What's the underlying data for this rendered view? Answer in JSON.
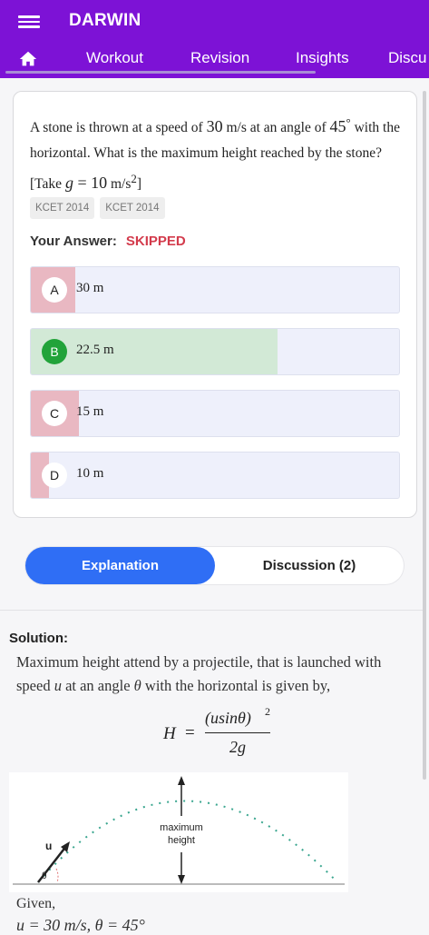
{
  "app": {
    "title": "DARWIN"
  },
  "nav": {
    "tabs": [
      "Workout",
      "Revision",
      "Insights",
      "Discu"
    ]
  },
  "question": {
    "line1_a": "A stone is thrown at a speed of ",
    "speed": "30",
    "line1_b": " m/s at an angle of ",
    "angle": "45",
    "deg": "°",
    "line1_c": " with the horizontal. What is the maximum height reached by the stone? [Take ",
    "g_sym": "g",
    "eq": " = ",
    "g_val": "10",
    "unit": " m/s",
    "sup": "2",
    "close": "]"
  },
  "tags": [
    "KCET 2014",
    "KCET 2014"
  ],
  "your_answer": {
    "label": "Your Answer:",
    "status": "SKIPPED"
  },
  "options": [
    {
      "letter": "A",
      "text": "30 m",
      "fill_fraction": 0.12,
      "fill_color": "#e9b8c2",
      "correct": false
    },
    {
      "letter": "B",
      "text": "22.5 m",
      "fill_fraction": 0.67,
      "fill_color": "#d2e9d6",
      "correct": true
    },
    {
      "letter": "C",
      "text": "15 m",
      "fill_fraction": 0.13,
      "fill_color": "#e9b8c2",
      "correct": false
    },
    {
      "letter": "D",
      "text": "10 m",
      "fill_fraction": 0.05,
      "fill_color": "#e9b8c2",
      "correct": false
    }
  ],
  "toggle": {
    "explanation": "Explanation",
    "discussion": "Discussion (2)"
  },
  "solution": {
    "heading": "Solution:",
    "text_a": "Maximum height attend by a projectile, that is launched with speed ",
    "u": "u",
    "text_b": " at an angle ",
    "theta": "θ",
    "text_c": " with the horizontal is given by,",
    "formula_H": "H",
    "formula_eq": "=",
    "formula_num": "(usinθ)",
    "formula_sup": "2",
    "formula_den": "2g",
    "figure": {
      "label_max": "maximum",
      "label_height": "height",
      "label_u": "u",
      "label_theta": "θ"
    },
    "given": "Given,",
    "given_line": "u = 30 m/s, θ = 45°"
  },
  "colors": {
    "header": "#7d12d6",
    "accent_blue": "#2f6ef5",
    "skipped": "#d33b4c",
    "correct": "#22a33a"
  }
}
